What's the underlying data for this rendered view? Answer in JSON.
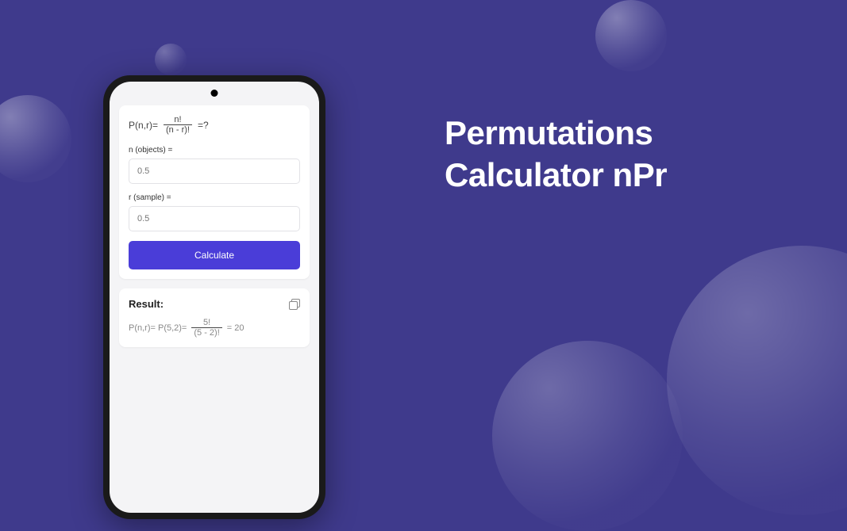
{
  "title_line1": "Permutations",
  "title_line2": "Calculator nPr",
  "formula": {
    "lhs": "P(n,r)=",
    "num": "n!",
    "den": "(n - r)!",
    "suffix": "=?"
  },
  "inputs": {
    "n_label": "n (objects) =",
    "n_value": "0.5",
    "r_label": "r (sample) =",
    "r_value": "0.5"
  },
  "calculate_btn": "Calculate",
  "result": {
    "heading": "Result:",
    "lhs": "P(n,r)= P(5,2)=",
    "num": "5!",
    "den": "(5 - 2)!",
    "equals": "= 20"
  }
}
